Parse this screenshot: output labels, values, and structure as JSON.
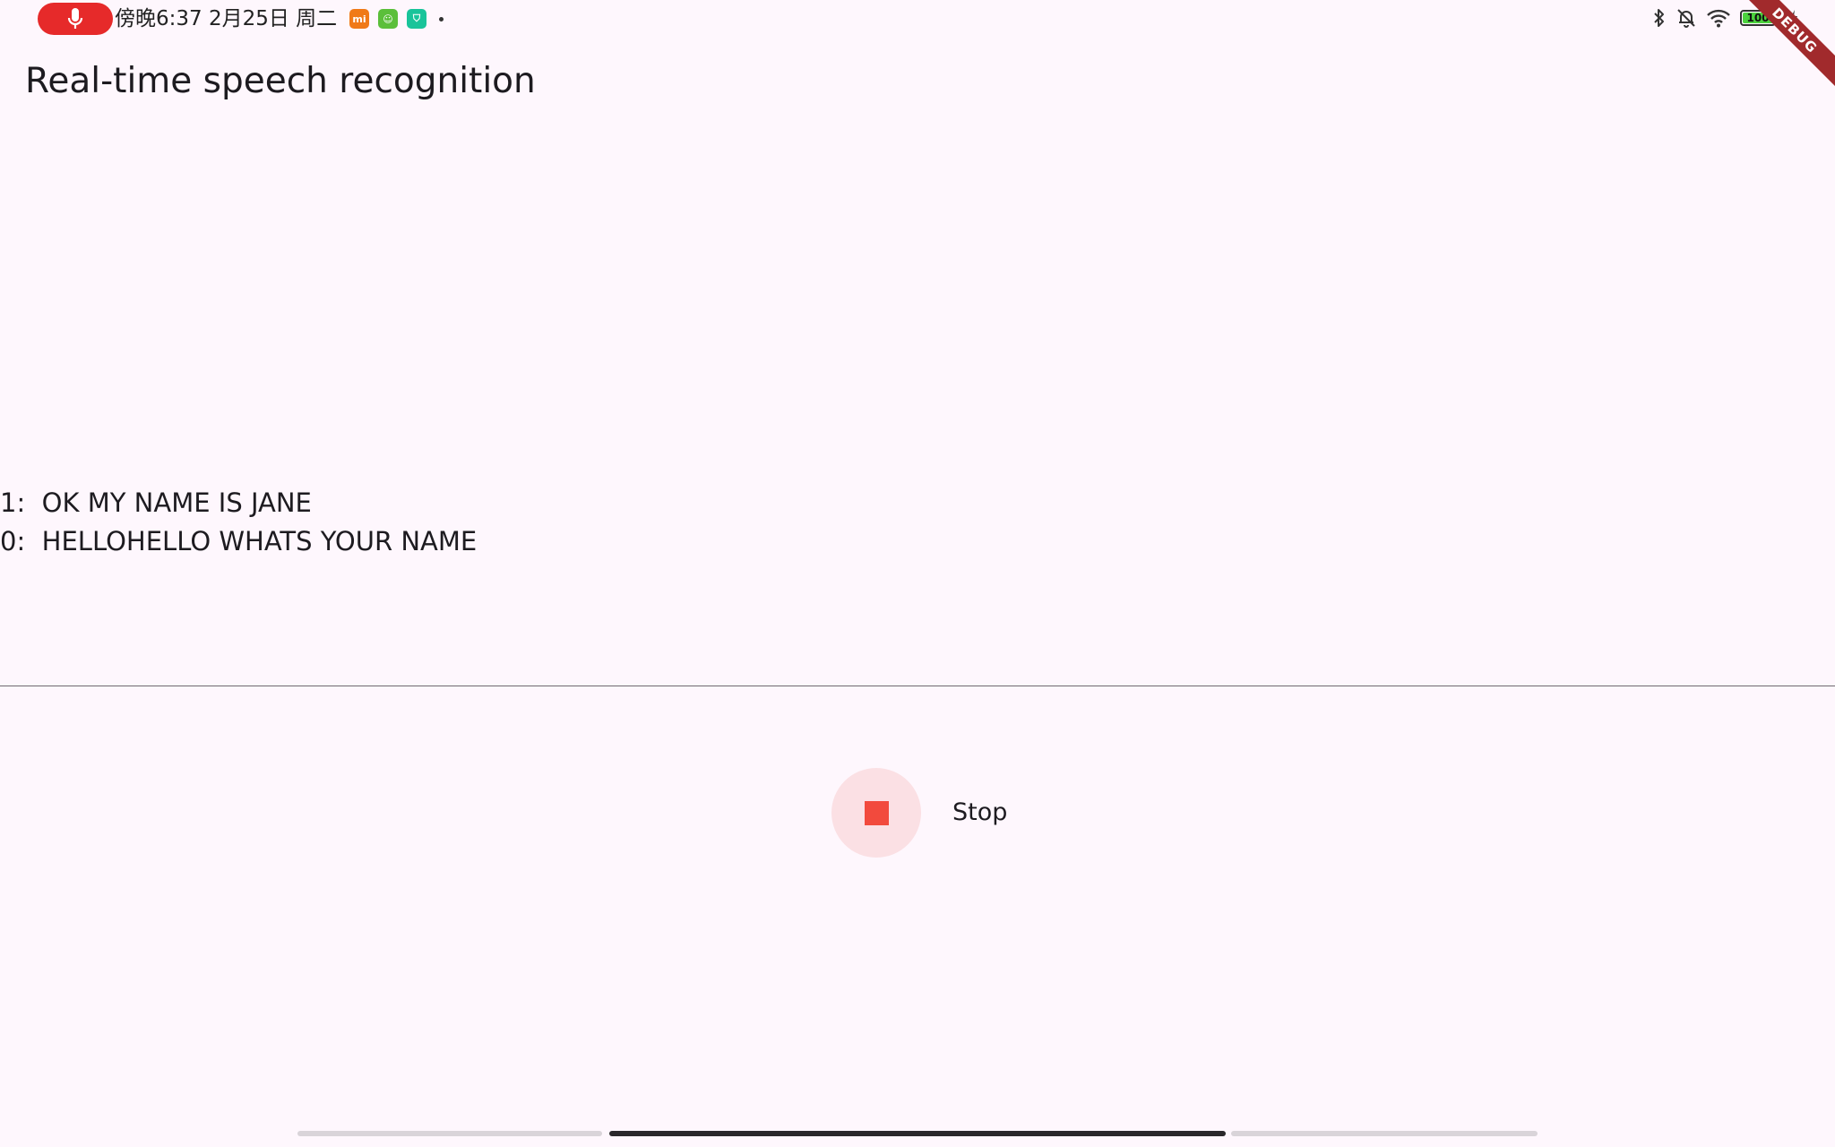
{
  "status_bar": {
    "time_text": "傍晚6:37 2月25日 周二",
    "recording_indicator_icon": "microphone-icon",
    "notification_icons": [
      {
        "name": "mi-app-icon",
        "label": "mi",
        "color": "#f07a17"
      },
      {
        "name": "green-app-icon",
        "label": "☺",
        "color": "#5bbf3a"
      },
      {
        "name": "shield-app-icon",
        "label": "⛉",
        "color": "#19c49a"
      }
    ],
    "more_dot": "•",
    "system_icons": [
      "bluetooth-icon",
      "mute-bell-icon",
      "wifi-icon",
      "battery-icon",
      "charging-icon"
    ],
    "battery_level": "100"
  },
  "debug_banner": "DEBUG",
  "app_bar": {
    "title": "Real-time speech recognition"
  },
  "transcript": [
    {
      "index": "1:",
      "text": "OK MY NAME IS JANE"
    },
    {
      "index": "0:",
      "text": "HELLOHELLO WHATS YOUR NAME"
    }
  ],
  "controls": {
    "stop_icon": "stop-icon",
    "stop_label": "Stop",
    "accent_color": "#f24a3d"
  }
}
